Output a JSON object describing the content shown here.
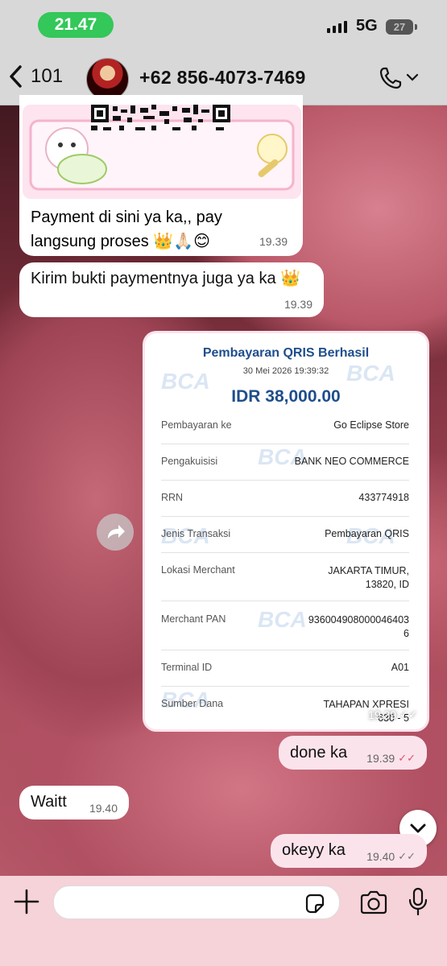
{
  "status_bar": {
    "time": "21.47",
    "network": "5G",
    "battery": "27"
  },
  "header": {
    "back_count": "101",
    "contact_name": "+62 856-4073-7469"
  },
  "messages": [
    {
      "direction": "in",
      "text": "Payment di sini ya ka,, pay langsung proses 👑🙏🏻😊",
      "time": "19.39"
    },
    {
      "direction": "in",
      "text": "Kirim bukti paymentnya juga ya ka 👑",
      "time": "19.39"
    },
    {
      "direction": "in",
      "type": "image",
      "time": "19.39",
      "status": "read"
    },
    {
      "direction": "out",
      "text": "done ka",
      "time": "19.39",
      "status": "read"
    },
    {
      "direction": "in",
      "text": "Waitt",
      "time": "19.40"
    },
    {
      "direction": "out",
      "text": "okeyy ka",
      "time": "19.40",
      "status": "delivered"
    }
  ],
  "receipt": {
    "title": "Pembayaran QRIS Berhasil",
    "datetime": "30 Mei 2026 19:39:32",
    "amount": "IDR 38,000.00",
    "watermark": "BCA",
    "rows": [
      {
        "label": "Pembayaran ke",
        "value": "Go Eclipse Store"
      },
      {
        "label": "Pengakuisisi",
        "value": "BANK NEO COMMERCE"
      },
      {
        "label": "RRN",
        "value": "433774918"
      },
      {
        "label": "Jenis Transaksi",
        "value": "Pembayaran QRIS"
      },
      {
        "label": "Lokasi Merchant",
        "value": "JAKARTA TIMUR,\n13820, ID"
      },
      {
        "label": "Merchant PAN",
        "value": "93600490800004640​3\n6"
      },
      {
        "label": "Terminal ID",
        "value": "A01"
      },
      {
        "label": "Sumber Dana",
        "value": "TAHAPAN XPRESI\n630 - 5"
      }
    ]
  },
  "colors": {
    "accent_green": "#34c759",
    "outgoing_bubble": "#fbe3ec",
    "incoming_bubble": "#ffffff",
    "bca_blue": "#1f4e8c",
    "read_tick": "#e0506a"
  },
  "icons": [
    "back-chevron-icon",
    "phone-icon",
    "chevron-down-icon",
    "forward-icon",
    "plus-icon",
    "sticker-icon",
    "camera-icon",
    "microphone-icon"
  ]
}
